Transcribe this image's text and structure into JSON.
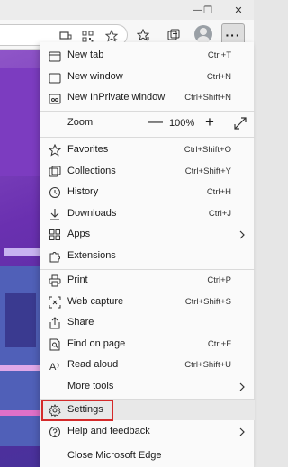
{
  "window": {
    "minimize_glyph": "—",
    "restore_glyph": "❐",
    "close_glyph": "✕"
  },
  "toolbar": {
    "more_glyph": "···"
  },
  "menu": {
    "new_tab": {
      "label": "New tab",
      "shortcut": "Ctrl+T"
    },
    "new_window": {
      "label": "New window",
      "shortcut": "Ctrl+N"
    },
    "new_inprivate": {
      "label": "New InPrivate window",
      "shortcut": "Ctrl+Shift+N"
    },
    "zoom": {
      "label": "Zoom",
      "value": "100%",
      "minus": "—",
      "plus": "+"
    },
    "favorites": {
      "label": "Favorites",
      "shortcut": "Ctrl+Shift+O"
    },
    "collections": {
      "label": "Collections",
      "shortcut": "Ctrl+Shift+Y"
    },
    "history": {
      "label": "History",
      "shortcut": "Ctrl+H"
    },
    "downloads": {
      "label": "Downloads",
      "shortcut": "Ctrl+J"
    },
    "apps": {
      "label": "Apps"
    },
    "extensions": {
      "label": "Extensions"
    },
    "print": {
      "label": "Print",
      "shortcut": "Ctrl+P"
    },
    "web_capture": {
      "label": "Web capture",
      "shortcut": "Ctrl+Shift+S"
    },
    "share": {
      "label": "Share"
    },
    "find": {
      "label": "Find on page",
      "shortcut": "Ctrl+F"
    },
    "read_aloud": {
      "label": "Read aloud",
      "shortcut": "Ctrl+Shift+U"
    },
    "more_tools": {
      "label": "More tools"
    },
    "settings": {
      "label": "Settings"
    },
    "help": {
      "label": "Help and feedback"
    },
    "close_edge": {
      "label": "Close Microsoft Edge"
    }
  },
  "colors": {
    "highlight": "#d42a2a",
    "page_purple": "#6a30b0",
    "cursor_red": "#e02020"
  }
}
